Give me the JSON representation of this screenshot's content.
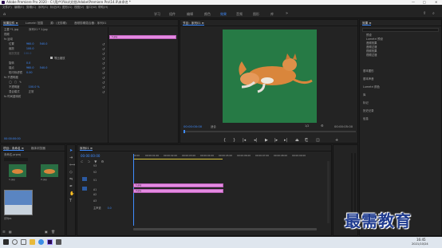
{
  "window": {
    "title": "Adobe Premiere Pro 2020 - C:\\用户\\Ykkz\\文档\\Adobe\\Premiere Pro\\14.0\\未命名 *",
    "controls": [
      "—",
      "□",
      "✕"
    ]
  },
  "menu": [
    "文件(F)",
    "编辑(E)",
    "剪辑(C)",
    "序列(S)",
    "标记(M)",
    "图形(G)",
    "视图(V)",
    "窗口(W)",
    "帮助(H)"
  ],
  "workspaces": [
    "学习",
    "组件",
    "编辑",
    "颜色",
    "效果",
    "音频",
    "图形",
    "库"
  ],
  "workspace_active": "效果",
  "effect_controls": {
    "tabs": [
      "效果控件 ≡",
      "Lumetri 范围",
      "源：(无剪辑)",
      "音频剪辑混合器：序列01"
    ],
    "source": "主要 *1.jpg",
    "sequence": "序列01 * 1.jpg",
    "rows": [
      {
        "label": "视频",
        "value": ""
      },
      {
        "label": "fx 运动",
        "value": ""
      },
      {
        "label": "位置",
        "value": "960.0",
        "value2": "540.0"
      },
      {
        "label": "缩放",
        "value": "100.0"
      },
      {
        "label": "缩放宽度",
        "value": "100.0"
      },
      {
        "label": "",
        "value": "等比缩放"
      },
      {
        "label": "旋转",
        "value": "0.0"
      },
      {
        "label": "锚点",
        "value": "960.0",
        "value2": "540.0"
      },
      {
        "label": "防闪烁滤镜",
        "value": "0.00"
      },
      {
        "label": "fx 不透明度",
        "value": ""
      },
      {
        "label": "",
        "value": ""
      },
      {
        "label": "不透明度",
        "value": "100.0 %"
      },
      {
        "label": "混合模式",
        "value": "正常"
      },
      {
        "label": "fx 时间重映射",
        "value": ""
      }
    ],
    "clip_label": "1.jpg",
    "timecode": "00:00:00:00"
  },
  "program": {
    "tab": "节目：序列01 ≡",
    "timecode_left": "00:00:00:00",
    "fit": "适合",
    "zoom": "1/2",
    "timecode_right": "00:00:05:00"
  },
  "right_panel": {
    "title": "效果 ≡",
    "items": [
      "预设",
      "Lumetri 预设",
      "音频效果",
      "音频过渡",
      "视频效果",
      "视频过渡"
    ],
    "sections": [
      "基本图形",
      "基本声音",
      "Lumetri 颜色",
      "库",
      "标记",
      "历史记录",
      "信息"
    ]
  },
  "project": {
    "tabs": [
      "项目：未命名 ≡",
      "媒体浏览器"
    ],
    "name": "未命名.prproj",
    "items": [
      {
        "name": "1.jpg",
        "duration": "5:00"
      },
      {
        "name": "2.jpg",
        "duration": "5:00"
      },
      {
        "name": "序列01",
        "duration": "5:00"
      }
    ]
  },
  "timeline": {
    "tab": "序列01 ≡",
    "timecode": "00:00:00:00",
    "ruler": [
      "00:00",
      "00:00:01:00",
      "00:00:02:00",
      "00:00:03:00",
      "00:00:04:00",
      "00:00:05:00",
      "00:00:06:00",
      "00:00:07:00",
      "00:00:08:00",
      "00:00:09:00"
    ],
    "tracks": [
      "V3",
      "V2",
      "V1",
      "A1",
      "A2",
      "A3"
    ],
    "master": "主声道",
    "master_value": "0.0",
    "clips": [
      "1.jpg",
      "2.jpg"
    ]
  },
  "watermark": "最需教育",
  "taskbar": {
    "time": "16:45",
    "date": "2021/10/24"
  }
}
